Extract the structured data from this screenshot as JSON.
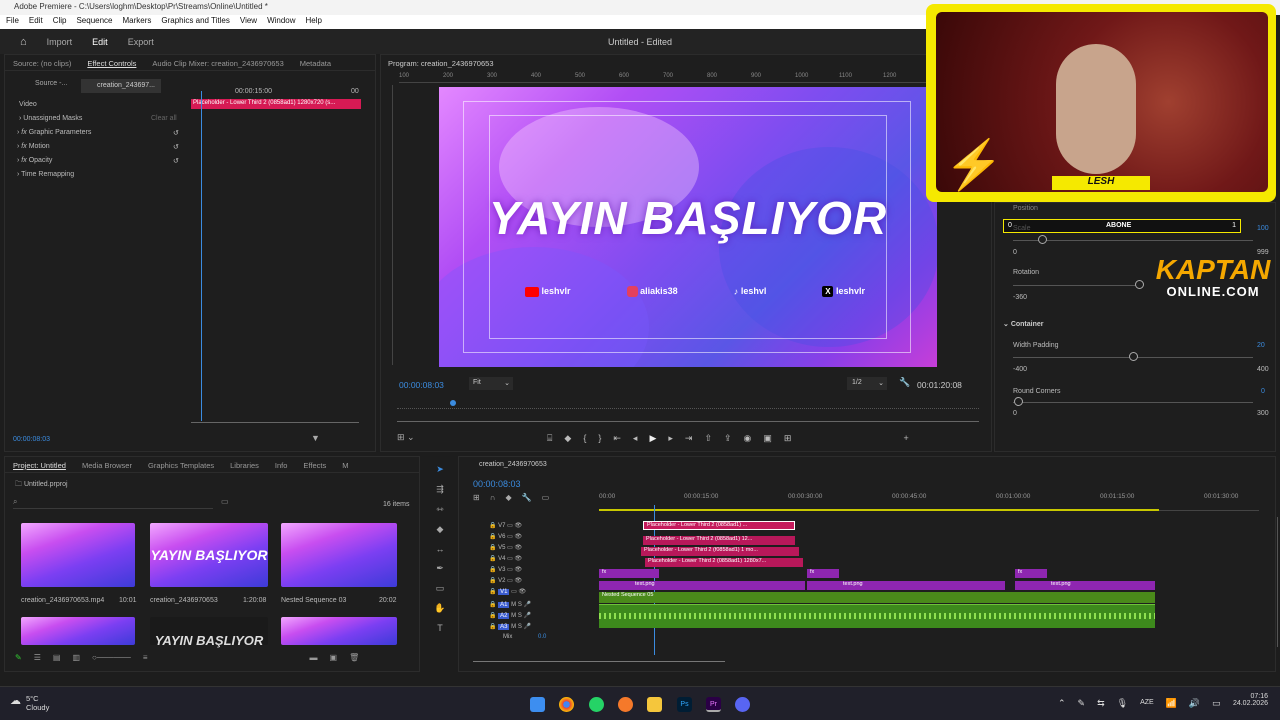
{
  "titlebar": {
    "text": "Adobe Premiere - C:\\Users\\loghm\\Desktop\\Pr\\Streams\\Online\\Untitled *"
  },
  "menu": [
    "File",
    "Edit",
    "Clip",
    "Sequence",
    "Markers",
    "Graphics and Titles",
    "View",
    "Window",
    "Help"
  ],
  "header": {
    "import": "Import",
    "edit": "Edit",
    "export": "Export",
    "doc_title": "Untitled - Edited"
  },
  "effect_panel": {
    "tabs": [
      "Source: (no clips)",
      "Effect Controls",
      "Audio Clip Mixer: creation_2436970653",
      "Metadata"
    ],
    "source_dd": "Source -...",
    "clip_dd": "creation_243697...",
    "timecode_ruler": "00:00:15:00",
    "timecode_end": "00",
    "video_label": "Video",
    "unassigned_masks": "Unassigned Masks",
    "clear_all": "Clear all",
    "fx_items": [
      "Graphic Parameters",
      "Motion",
      "Opacity",
      "Time Remapping"
    ],
    "clip_bar": "Placeholder - Lower Third 2 (0858ad1) 1280x720 (s...",
    "timecode": "00:00:08:03"
  },
  "program": {
    "title": "Program: creation_2436970653",
    "ruler": [
      "100",
      "200",
      "300",
      "400",
      "500",
      "600",
      "700",
      "800",
      "900",
      "1000",
      "1100",
      "1200"
    ],
    "headline": "YAYIN BAŞLIYOR",
    "socials": [
      {
        "icon": "youtube-icon",
        "label": "leshvlr"
      },
      {
        "icon": "instagram-icon",
        "label": "aliakis38"
      },
      {
        "icon": "tiktok-icon",
        "label": "leshvl"
      },
      {
        "icon": "x-icon",
        "label": "leshvlr"
      }
    ],
    "timecode": "00:00:08:03",
    "fit": "Fit",
    "resolution": "1/2",
    "duration": "00:01:20:08"
  },
  "webcam": {
    "name": "LESH"
  },
  "egp": {
    "position": "Position",
    "abone_left": "0",
    "abone_label": "ABONE",
    "abone_right": "1",
    "scale": "Scale",
    "v100": "100",
    "v0": "0",
    "v999": "999",
    "rotation": "Rotation",
    "rot_min": "-360",
    "container": "Container",
    "width_padding": "Width Padding",
    "wp_min": "-400",
    "wp_val": "20",
    "wp_max": "400",
    "round_corners": "Round Corners",
    "rc_val": "0",
    "rc_min": "0",
    "rc_max": "300"
  },
  "logo": {
    "line1": "KAPTAN",
    "line2": "ONLINE.COM"
  },
  "project": {
    "tabs": [
      "Project: Untitled",
      "Media Browser",
      "Graphics Templates",
      "Libraries",
      "Info",
      "Effects",
      "M"
    ],
    "file": "Untitled.prproj",
    "items_count": "16 items",
    "items": [
      {
        "name": "creation_2436970653.mp4",
        "dur": "10:01"
      },
      {
        "name": "creation_2436970653",
        "dur": "1:20:08"
      },
      {
        "name": "Nested Sequence 03",
        "dur": "20:02"
      }
    ],
    "thumb_text": "YAYIN BAŞLIYOR",
    "thumb_text2": "YAYIN BAŞLIYOR"
  },
  "timeline": {
    "tab": "creation_2436970653",
    "timecode": "00:00:08:03",
    "ruler": [
      "00:00",
      "00:00:15:00",
      "00:00:30:00",
      "00:00:45:00",
      "00:01:00:00",
      "00:01:15:00",
      "00:01:30:00"
    ],
    "tracks": [
      "V7",
      "V6",
      "V5",
      "V4",
      "V3",
      "V2",
      "V1",
      "A1",
      "A2",
      "A3"
    ],
    "mix": "Mix",
    "mix_val": "0.0",
    "clips": {
      "v7": "Placeholder - Lower Third 2 (0858ad1) ...",
      "v6": "Placeholder - Lower Third 2 (0858ad1) 12...",
      "v5": "Placeholder - Lower Third 2 (f0858ad1) 1 mo...",
      "v4": "Placeholder - Lower Third 2 (0858ad1) 1280x7...",
      "text1": "text.png",
      "text2": "text.png",
      "text3": "text.png",
      "nested": "Nested Sequence 05",
      "fx": "fx"
    }
  },
  "taskbar": {
    "temp": "5°C",
    "weather": "Cloudy",
    "lang": "AZE",
    "time": "07:16",
    "date": "24.02.2026"
  }
}
